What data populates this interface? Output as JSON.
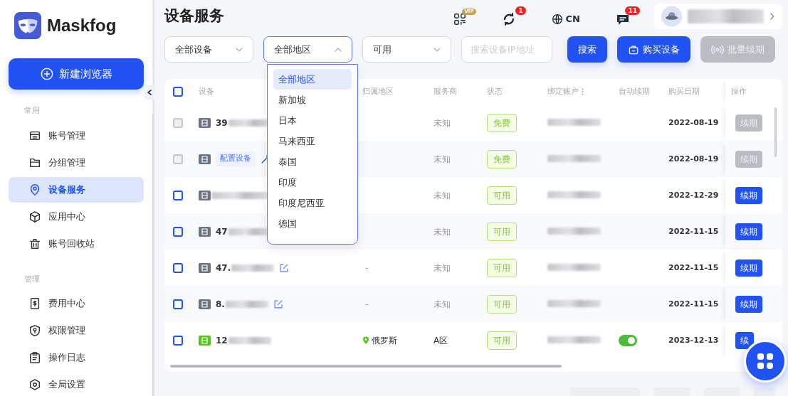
{
  "brand": {
    "name": "Maskfog"
  },
  "new_button": {
    "label": "新建浏览器"
  },
  "sidebar": {
    "sections": [
      {
        "title": "常用",
        "items": [
          {
            "label": "账号管理",
            "selected": false
          },
          {
            "label": "分组管理",
            "selected": false
          },
          {
            "label": "设备服务",
            "selected": true
          },
          {
            "label": "应用中心",
            "selected": false
          },
          {
            "label": "账号回收站",
            "selected": false
          }
        ]
      },
      {
        "title": "管理",
        "items": [
          {
            "label": "费用中心",
            "selected": false
          },
          {
            "label": "权限管理",
            "selected": false
          },
          {
            "label": "操作日志",
            "selected": false
          },
          {
            "label": "全局设置",
            "selected": false
          }
        ]
      }
    ]
  },
  "header": {
    "title": "设备服务",
    "vip_badge": "VIP",
    "sync_count": "1",
    "language": "CN",
    "message_count": "11"
  },
  "filters": {
    "selects": [
      {
        "value": "全部设备",
        "open": false
      },
      {
        "value": "全部地区",
        "open": true
      },
      {
        "value": "可用",
        "open": false
      }
    ],
    "search": {
      "placeholder": "搜索设备IP地址"
    },
    "buttons": [
      {
        "label": "搜索",
        "kind": "plain",
        "disabled": false
      },
      {
        "label": "购买设备",
        "kind": "bag",
        "disabled": false
      },
      {
        "label": "批量续期",
        "kind": "renew",
        "disabled": true
      }
    ]
  },
  "region_dropdown": {
    "options": [
      {
        "label": "全部地区",
        "selected": true
      },
      {
        "label": "新加坡",
        "selected": false
      },
      {
        "label": "日本",
        "selected": false
      },
      {
        "label": "马来西亚",
        "selected": false
      },
      {
        "label": "泰国",
        "selected": false
      },
      {
        "label": "印度",
        "selected": false
      },
      {
        "label": "印度尼西亚",
        "selected": false
      },
      {
        "label": "德国",
        "selected": false
      }
    ]
  },
  "table": {
    "select_all": {
      "checked": false
    },
    "columns": [
      "设备",
      "归属地区",
      "服务商",
      "状态",
      "绑定账户",
      "自动续期",
      "购买日期",
      "操作"
    ],
    "rows": [
      {
        "disabled": true,
        "color": "#6b7280",
        "device": {
          "kind": "plain",
          "text": "39"
        },
        "provider": "未知",
        "status": "免费",
        "date": "2022-08-19",
        "action": "续期"
      },
      {
        "disabled": true,
        "color": "#6b7280",
        "device": {
          "kind": "config",
          "text": "配置设备"
        },
        "provider": "未知",
        "status": "免费",
        "date": "2022-08-19",
        "action": "续期"
      },
      {
        "disabled": false,
        "color": "#6b7280",
        "device": {
          "kind": "plain"
        },
        "provider": "未知",
        "status": "可用",
        "date": "2022-12-29",
        "action": "续期"
      },
      {
        "disabled": false,
        "color": "#6b7280",
        "device": {
          "kind": "plain",
          "text": "47"
        },
        "provider": "未知",
        "status": "可用",
        "date": "2022-11-15",
        "action": "续期"
      },
      {
        "disabled": false,
        "color": "#6b7280",
        "device": {
          "kind": "editable",
          "text": "47."
        },
        "region": {
          "kind": "empty",
          "text": "-"
        },
        "provider": "未知",
        "status": "可用",
        "date": "2022-11-15",
        "action": "续期"
      },
      {
        "disabled": false,
        "color": "#6b7280",
        "device": {
          "kind": "editable",
          "text": "8."
        },
        "region": {
          "kind": "empty",
          "text": "-"
        },
        "provider": "未知",
        "status": "可用",
        "date": "2022-11-15",
        "action": "续期"
      },
      {
        "disabled": false,
        "color": "#52c41a",
        "device": {
          "kind": "plain",
          "text": "12"
        },
        "region": {
          "kind": "location",
          "text": "俄罗斯"
        },
        "provider": "A区",
        "status": "可用",
        "auto_renew": true,
        "date": "2023-12-13",
        "action": "续"
      }
    ]
  }
}
